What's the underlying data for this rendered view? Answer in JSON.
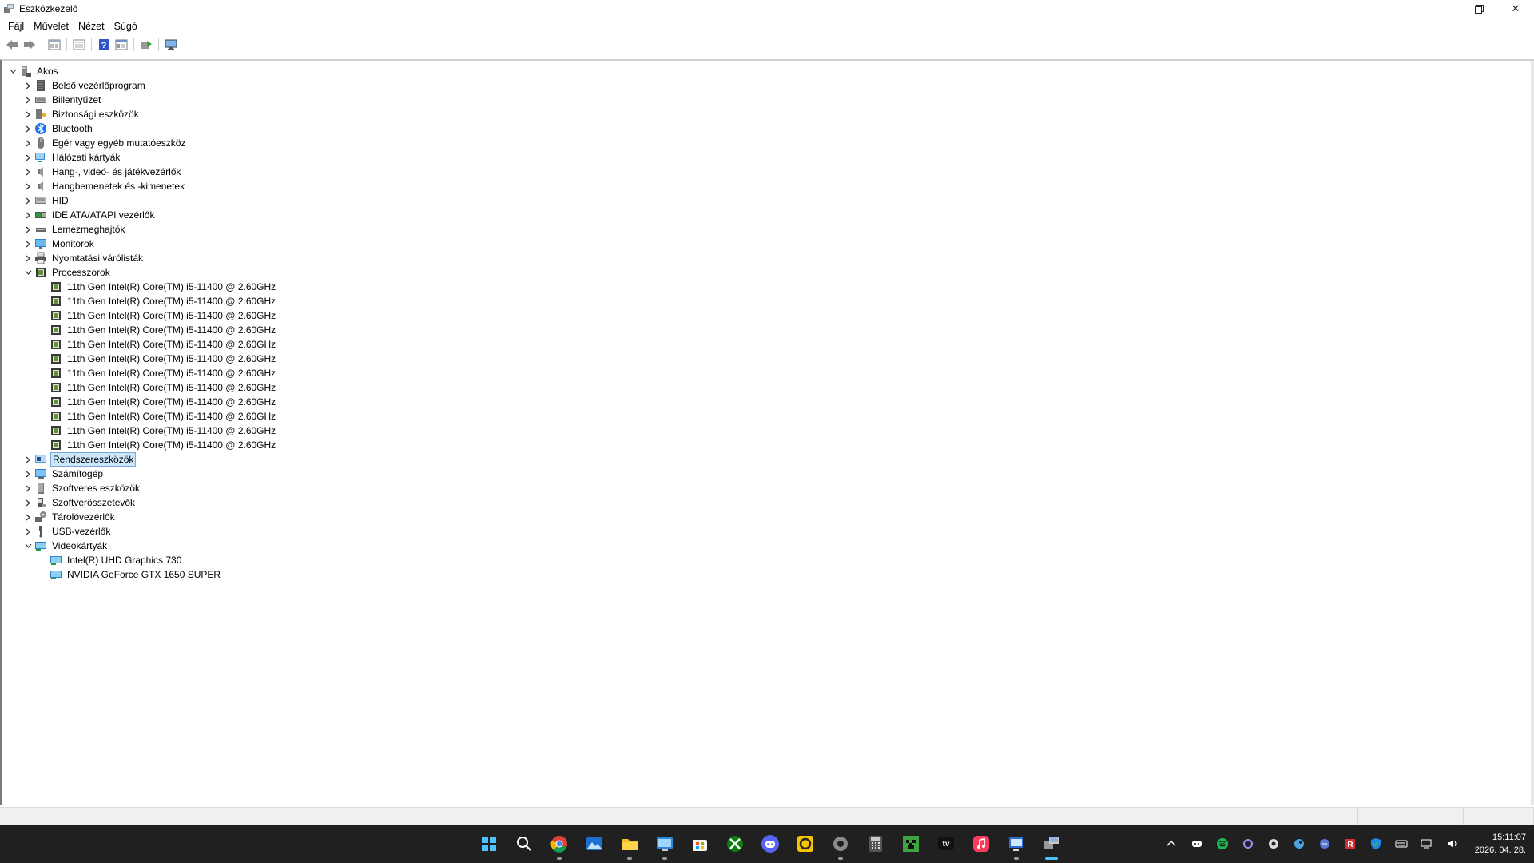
{
  "window": {
    "title": "Eszközkezelő"
  },
  "menu": [
    "Fájl",
    "Művelet",
    "Nézet",
    "Súgó"
  ],
  "toolbar": [
    "back-arrow-icon",
    "forward-arrow-icon",
    "properties-icon",
    "show-hide-tree-icon",
    "help-icon",
    "action-view-icon",
    "update-driver-icon",
    "scan-hardware-icon"
  ],
  "tree": {
    "root": "Akos",
    "categories": [
      {
        "label": "Belső vezérlőprogram",
        "icon": "firmware-icon",
        "expanded": false
      },
      {
        "label": "Billentyűzet",
        "icon": "keyboard-icon",
        "expanded": false
      },
      {
        "label": "Biztonsági eszközök",
        "icon": "security-device-icon",
        "expanded": false
      },
      {
        "label": "Bluetooth",
        "icon": "bluetooth-icon",
        "expanded": false
      },
      {
        "label": "Egér vagy egyéb mutatóeszköz",
        "icon": "mouse-icon",
        "expanded": false
      },
      {
        "label": "Hálózati kártyák",
        "icon": "network-adapter-icon",
        "expanded": false
      },
      {
        "label": "Hang-, videó- és játékvezérlők",
        "icon": "speaker-icon",
        "expanded": false
      },
      {
        "label": "Hangbemenetek és -kimenetek",
        "icon": "speaker-icon",
        "expanded": false
      },
      {
        "label": "HID",
        "icon": "hid-icon",
        "expanded": false
      },
      {
        "label": "IDE ATA/ATAPI vezérlők",
        "icon": "ide-controller-icon",
        "expanded": false
      },
      {
        "label": "Lemezmeghajtók",
        "icon": "disk-drive-icon",
        "expanded": false
      },
      {
        "label": "Monitorok",
        "icon": "monitor-icon",
        "expanded": false
      },
      {
        "label": "Nyomtatási várólisták",
        "icon": "printer-icon",
        "expanded": false
      },
      {
        "label": "Processzorok",
        "icon": "processor-icon",
        "expanded": true,
        "children": [
          "11th Gen Intel(R) Core(TM) i5-11400 @ 2.60GHz",
          "11th Gen Intel(R) Core(TM) i5-11400 @ 2.60GHz",
          "11th Gen Intel(R) Core(TM) i5-11400 @ 2.60GHz",
          "11th Gen Intel(R) Core(TM) i5-11400 @ 2.60GHz",
          "11th Gen Intel(R) Core(TM) i5-11400 @ 2.60GHz",
          "11th Gen Intel(R) Core(TM) i5-11400 @ 2.60GHz",
          "11th Gen Intel(R) Core(TM) i5-11400 @ 2.60GHz",
          "11th Gen Intel(R) Core(TM) i5-11400 @ 2.60GHz",
          "11th Gen Intel(R) Core(TM) i5-11400 @ 2.60GHz",
          "11th Gen Intel(R) Core(TM) i5-11400 @ 2.60GHz",
          "11th Gen Intel(R) Core(TM) i5-11400 @ 2.60GHz",
          "11th Gen Intel(R) Core(TM) i5-11400 @ 2.60GHz"
        ]
      },
      {
        "label": "Rendszereszközök",
        "icon": "system-devices-icon",
        "expanded": false,
        "selected": true
      },
      {
        "label": "Számítógép",
        "icon": "computer-icon",
        "expanded": false
      },
      {
        "label": "Szoftveres eszközök",
        "icon": "software-device-icon",
        "expanded": false
      },
      {
        "label": "Szoftverösszetevők",
        "icon": "software-component-icon",
        "expanded": false
      },
      {
        "label": "Tárolóvezérlők",
        "icon": "storage-controller-icon",
        "expanded": false
      },
      {
        "label": "USB-vezérlők",
        "icon": "usb-icon",
        "expanded": false
      },
      {
        "label": "Videokártyák",
        "icon": "display-adapter-icon",
        "expanded": true,
        "children": [
          "Intel(R) UHD Graphics 730",
          "NVIDIA GeForce GTX 1650 SUPER"
        ]
      }
    ]
  },
  "taskbar": {
    "apps": [
      {
        "icon": "windows-start-icon",
        "running": false
      },
      {
        "icon": "search-icon",
        "running": false
      },
      {
        "icon": "chrome-icon",
        "running": true
      },
      {
        "icon": "photos-icon",
        "running": false
      },
      {
        "icon": "file-explorer-icon",
        "running": true
      },
      {
        "icon": "remote-desktop-icon",
        "running": true
      },
      {
        "icon": "microsoft-store-icon",
        "running": false
      },
      {
        "icon": "xbox-icon",
        "running": false
      },
      {
        "icon": "discord-icon",
        "running": false
      },
      {
        "icon": "sync-app-icon",
        "running": false
      },
      {
        "icon": "settings-icon",
        "running": true
      },
      {
        "icon": "calculator-icon",
        "running": false
      },
      {
        "icon": "minecraft-icon",
        "running": false
      },
      {
        "icon": "apple-tv-icon",
        "running": false
      },
      {
        "icon": "apple-music-icon",
        "running": false
      },
      {
        "icon": "control-panel-icon",
        "running": true
      },
      {
        "icon": "device-manager-icon",
        "running": true,
        "active": true
      }
    ],
    "tray": [
      "chevron-up-icon",
      "discord-tray-icon",
      "spotify-tray-icon",
      "tray-app-icon",
      "chrome-tray-icon",
      "steam-tray-icon",
      "vpn-tray-icon",
      "r-tray-icon",
      "defender-tray-icon",
      "keyboard-tray-icon",
      "network-tray-icon",
      "volume-tray-icon"
    ],
    "appletv_label": "tv",
    "time": "15:11:07",
    "date": "2026. 04. 28."
  }
}
